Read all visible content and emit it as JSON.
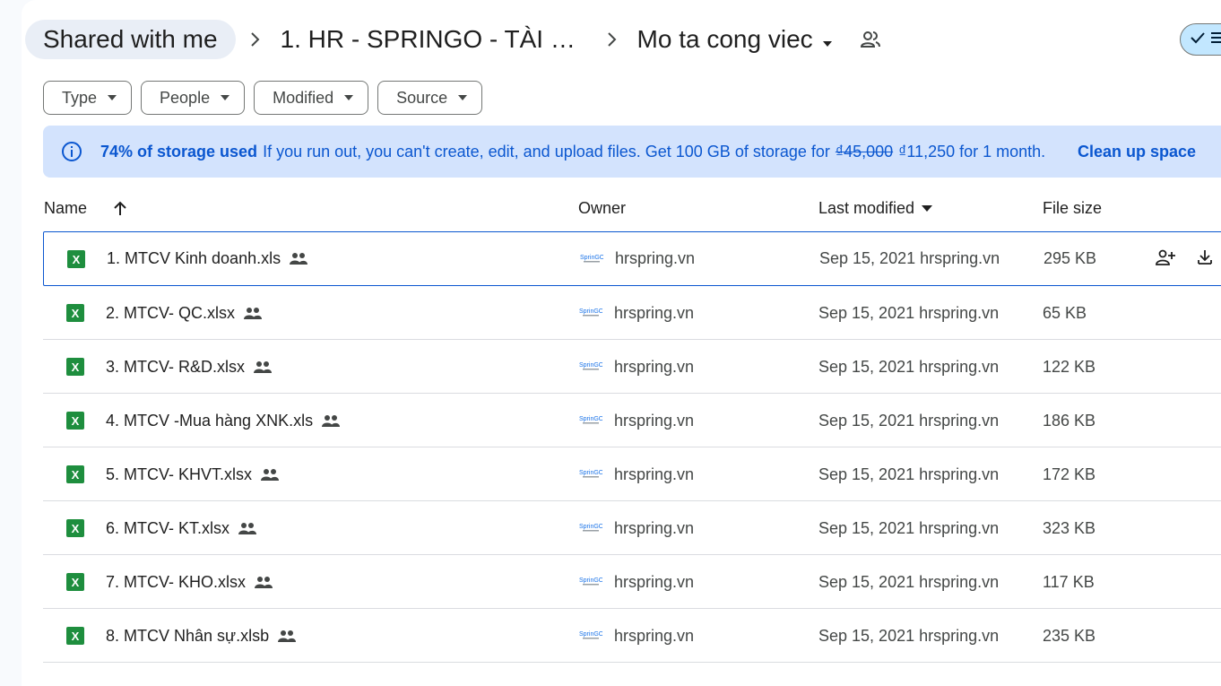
{
  "breadcrumb": {
    "root": "Shared with me",
    "parent": "1. HR - SPRINGO - TÀI L...",
    "current": "Mo ta cong viec"
  },
  "filters": [
    {
      "label": "Type"
    },
    {
      "label": "People"
    },
    {
      "label": "Modified"
    },
    {
      "label": "Source"
    }
  ],
  "banner": {
    "bold": "74% of storage used",
    "message": "If you run out, you can't create, edit, and upload files. Get 100 GB of storage for",
    "old_price": "₫45,000",
    "new_price": "₫11,250 for 1 month.",
    "action": "Clean up space"
  },
  "table": {
    "headers": {
      "name": "Name",
      "owner": "Owner",
      "last_modified": "Last modified",
      "file_size": "File size"
    },
    "rows": [
      {
        "name": "1. MTCV Kinh doanh.xls",
        "owner": "hrspring.vn",
        "modified": "Sep 15, 2021 hrspring.vn",
        "size": "295 KB"
      },
      {
        "name": "2. MTCV- QC.xlsx",
        "owner": "hrspring.vn",
        "modified": "Sep 15, 2021 hrspring.vn",
        "size": "65 KB"
      },
      {
        "name": "3. MTCV- R&D.xlsx",
        "owner": "hrspring.vn",
        "modified": "Sep 15, 2021 hrspring.vn",
        "size": "122 KB"
      },
      {
        "name": "4. MTCV -Mua hàng XNK.xls",
        "owner": "hrspring.vn",
        "modified": "Sep 15, 2021 hrspring.vn",
        "size": "186 KB"
      },
      {
        "name": "5. MTCV- KHVT.xlsx",
        "owner": "hrspring.vn",
        "modified": "Sep 15, 2021 hrspring.vn",
        "size": "172 KB"
      },
      {
        "name": "6. MTCV- KT.xlsx",
        "owner": "hrspring.vn",
        "modified": "Sep 15, 2021 hrspring.vn",
        "size": "323 KB"
      },
      {
        "name": "7. MTCV- KHO.xlsx",
        "owner": "hrspring.vn",
        "modified": "Sep 15, 2021 hrspring.vn",
        "size": "117 KB"
      },
      {
        "name": "8. MTCV Nhân sự.xlsb",
        "owner": "hrspring.vn",
        "modified": "Sep 15, 2021 hrspring.vn",
        "size": "235 KB"
      }
    ]
  },
  "file_icon_letter": "X",
  "icons": {
    "file": "excel-icon",
    "shared": "people-icon",
    "owner_logo": "springo-logo"
  },
  "colors": {
    "accent": "#0b57d0",
    "excel_green": "#1e8e3e",
    "banner_bg": "#d3e3fd"
  }
}
